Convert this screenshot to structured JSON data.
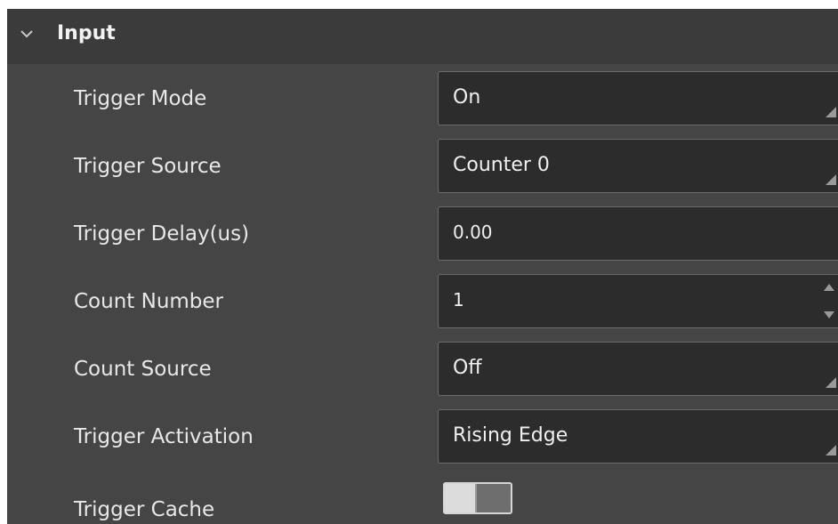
{
  "section": {
    "title": "Input",
    "expanded": true,
    "icon": "chevron-down-icon"
  },
  "fields": {
    "trigger_mode": {
      "label": "Trigger Mode",
      "value": "On",
      "control": "combobox"
    },
    "trigger_source": {
      "label": "Trigger Source",
      "value": "Counter 0",
      "control": "combobox"
    },
    "trigger_delay": {
      "label": "Trigger Delay(us)",
      "value": "0.00",
      "control": "text-input"
    },
    "count_number": {
      "label": "Count Number",
      "value": "1",
      "control": "spinbox"
    },
    "count_source": {
      "label": "Count Source",
      "value": "Off",
      "control": "combobox"
    },
    "trigger_activation": {
      "label": "Trigger Activation",
      "value": "Rising Edge",
      "control": "combobox"
    },
    "trigger_cache": {
      "label": "Trigger Cache",
      "value": false,
      "control": "toggle-switch"
    }
  },
  "colors": {
    "panel_bg": "#454545",
    "header_bg": "#3b3b3b",
    "field_bg": "#2c2c2c",
    "field_border": "#6b6b6b",
    "text": "#e8e8e8"
  }
}
